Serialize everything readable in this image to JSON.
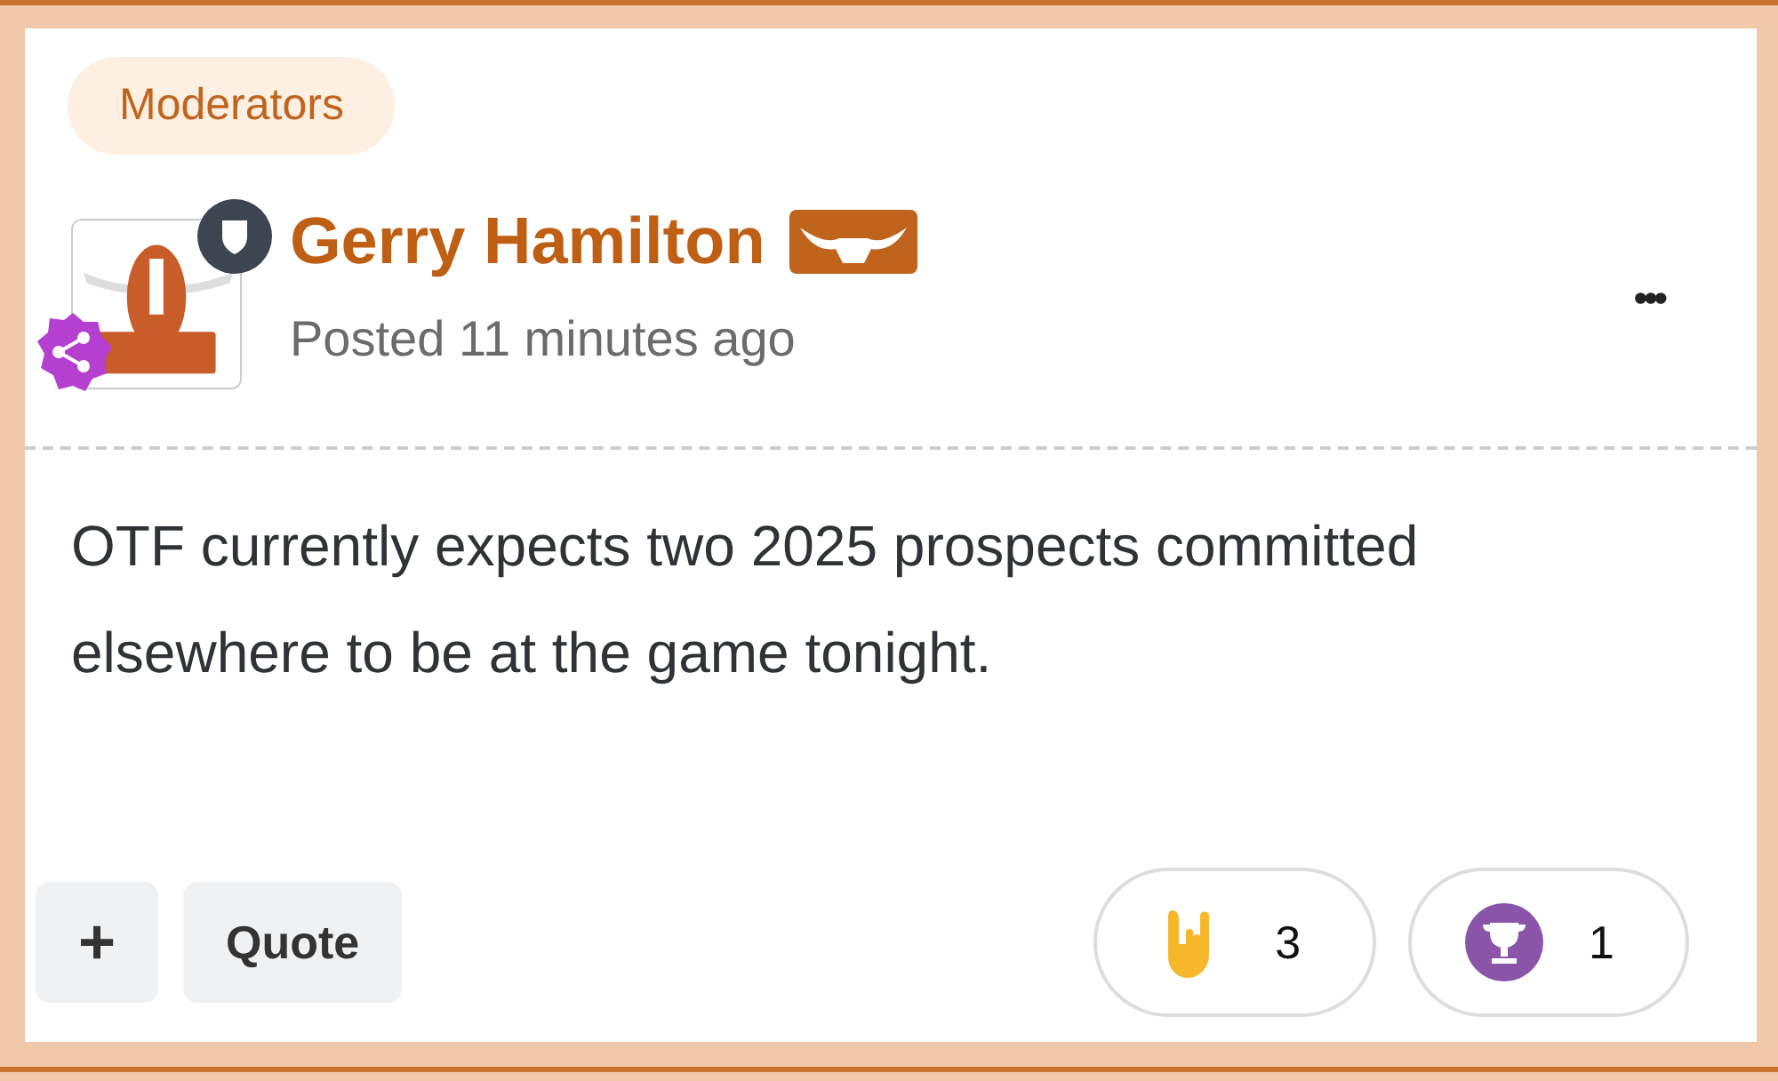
{
  "group_label": "Moderators",
  "post": {
    "author": "Gerry Hamilton",
    "posted": "Posted 11 minutes ago",
    "menu": "•••",
    "body": "OTF currently expects two 2025 prospects committed elsewhere to be at the game tonight."
  },
  "actions": [
    {
      "kind": "icon",
      "label": "+"
    },
    {
      "kind": "text",
      "label": "Quote"
    }
  ],
  "reactions": [
    {
      "kind": "horns",
      "count": "3"
    },
    {
      "kind": "trophy",
      "count": "1"
    }
  ]
}
